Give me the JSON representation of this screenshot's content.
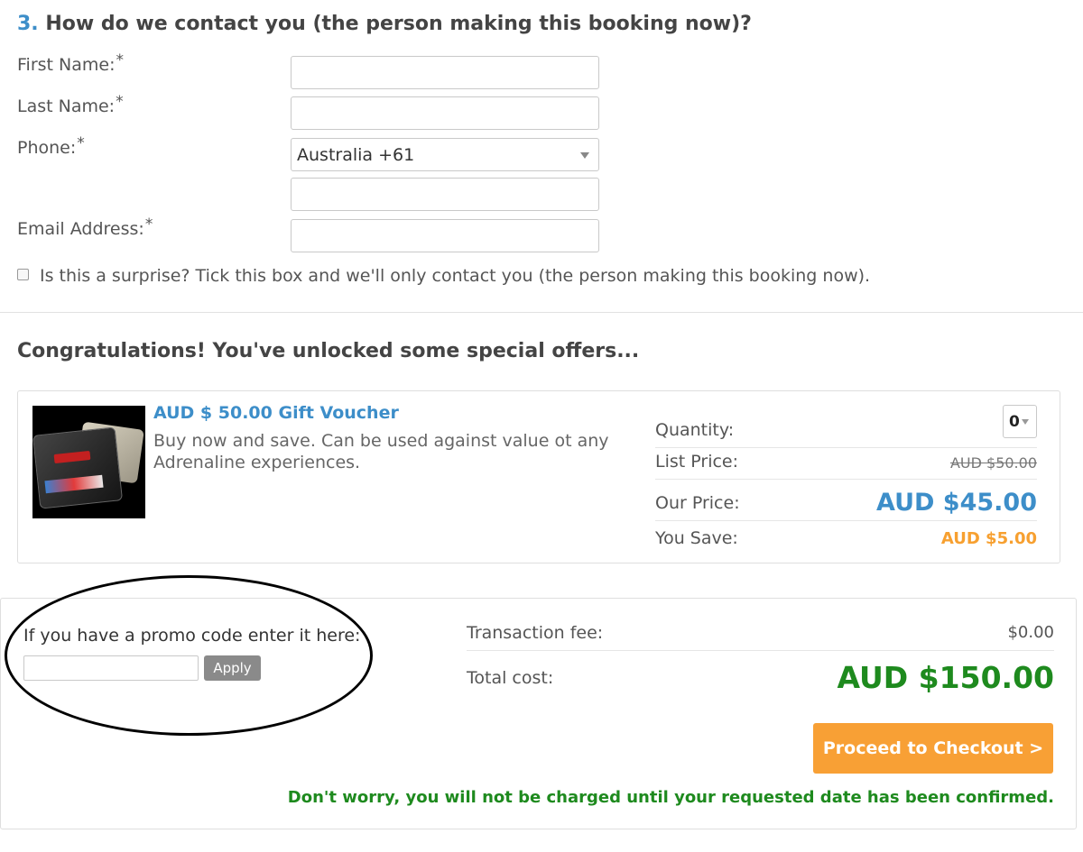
{
  "contact_section": {
    "number": "3.",
    "title": "How do we contact you (the person making this booking now)?",
    "required_mark": "*",
    "first_name_label": "First Name:",
    "last_name_label": "Last Name:",
    "phone_label": "Phone:",
    "phone_country": "Australia +61",
    "email_label": "Email Address:",
    "surprise_text": "Is this a surprise? Tick this box and we'll only contact you (the person making this booking now).",
    "surprise_checked": false
  },
  "offers": {
    "title": "Congratulations! You've unlocked some special offers...",
    "item": {
      "name": "AUD $ 50.00 Gift Voucher",
      "description": "Buy now and save. Can be used against value ot any Adrenaline experiences.",
      "quantity_label": "Quantity:",
      "quantity_value": "0",
      "list_price_label": "List Price:",
      "list_price": "AUD $50.00",
      "our_price_label": "Our Price:",
      "our_price": "AUD $45.00",
      "you_save_label": "You Save:",
      "you_save": "AUD $5.00"
    }
  },
  "summary": {
    "promo_label": "If you have a promo code enter it here:",
    "promo_value": "",
    "apply_label": "Apply",
    "fee_label": "Transaction fee:",
    "fee_value": "$0.00",
    "total_label": "Total cost:",
    "total_value": "AUD $150.00",
    "checkout_label": "Proceed to Checkout >",
    "reassurance": "Don't worry, you will not be charged until your requested date has been confirmed."
  },
  "colors": {
    "accent_blue": "#3d8ec9",
    "orange": "#f8a035",
    "green": "#1e8a1e"
  }
}
